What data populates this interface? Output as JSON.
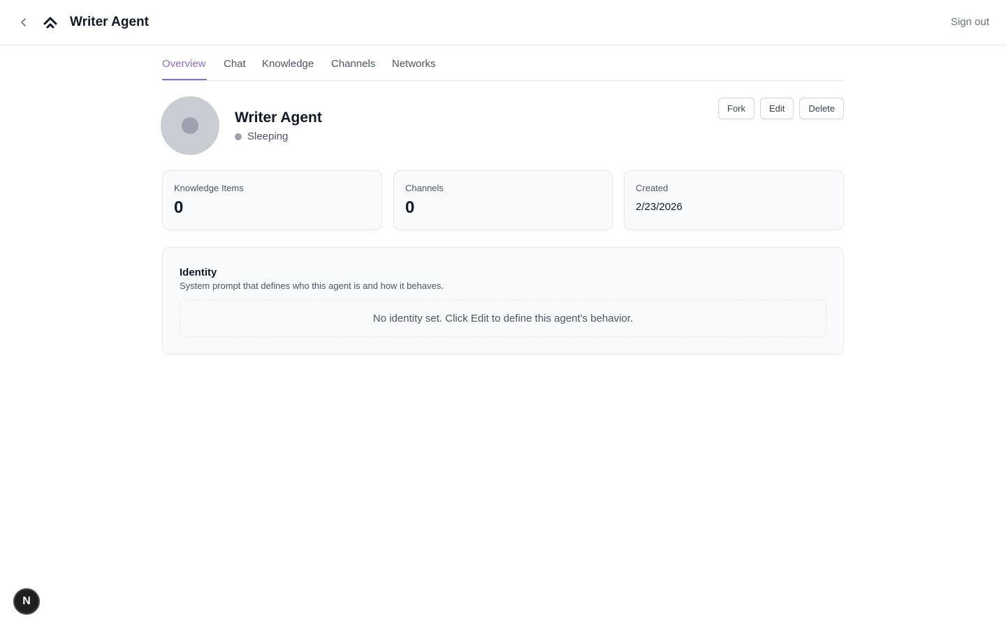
{
  "header": {
    "title": "Writer Agent",
    "sign_out_label": "Sign out",
    "back_icon": "chevron-left-icon",
    "logo_icon": "double-chevron-up-logo"
  },
  "tabs": [
    {
      "label": "Overview",
      "active": true
    },
    {
      "label": "Chat",
      "active": false
    },
    {
      "label": "Knowledge",
      "active": false
    },
    {
      "label": "Channels",
      "active": false
    },
    {
      "label": "Networks",
      "active": false
    }
  ],
  "agent": {
    "name": "Writer Agent",
    "status": "Sleeping",
    "status_color": "#9ca3af"
  },
  "actions": {
    "fork_label": "Fork",
    "edit_label": "Edit",
    "delete_label": "Delete"
  },
  "stats": [
    {
      "label": "Knowledge Items",
      "value": "0"
    },
    {
      "label": "Channels",
      "value": "0"
    },
    {
      "label": "Created",
      "value": "2/23/2026"
    }
  ],
  "identity": {
    "title": "Identity",
    "description": "System prompt that defines who this agent is and how it behaves.",
    "empty_message": "No identity set. Click Edit to define this agent's behavior."
  },
  "floating_badge": {
    "label": "N"
  },
  "colors": {
    "accent": "#8b6fd6",
    "border": "#e5e7eb",
    "card_bg": "#f9fafb"
  }
}
